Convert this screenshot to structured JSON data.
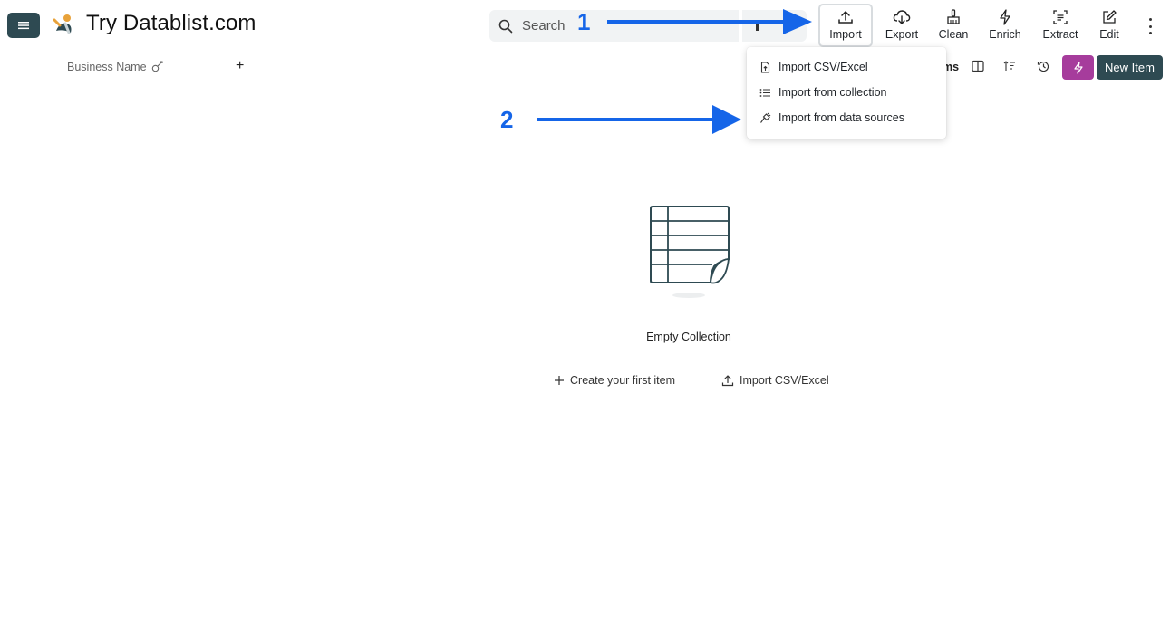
{
  "app": {
    "title": "Try Datablist.com"
  },
  "search": {
    "placeholder": "Search"
  },
  "toolbar": {
    "import": "Import",
    "export": "Export",
    "clean": "Clean",
    "enrich": "Enrich",
    "extract": "Extract",
    "edit": "Edit"
  },
  "table": {
    "column_header": "Business Name",
    "items_label": "ms"
  },
  "actions": {
    "new_item": "New Item"
  },
  "import_menu": {
    "items": [
      {
        "label": "Import CSV/Excel",
        "icon": "file-upload-icon"
      },
      {
        "label": "Import from collection",
        "icon": "list-icon"
      },
      {
        "label": "Import from data sources",
        "icon": "plug-icon"
      }
    ]
  },
  "annotations": {
    "step1": "1",
    "step2": "2",
    "color": "#1565e8"
  },
  "empty_state": {
    "title": "Empty Collection",
    "create_label": "Create your first item",
    "import_label": "Import CSV/Excel"
  },
  "colors": {
    "primary": "#2e4a52",
    "accent": "#a63c9c"
  }
}
